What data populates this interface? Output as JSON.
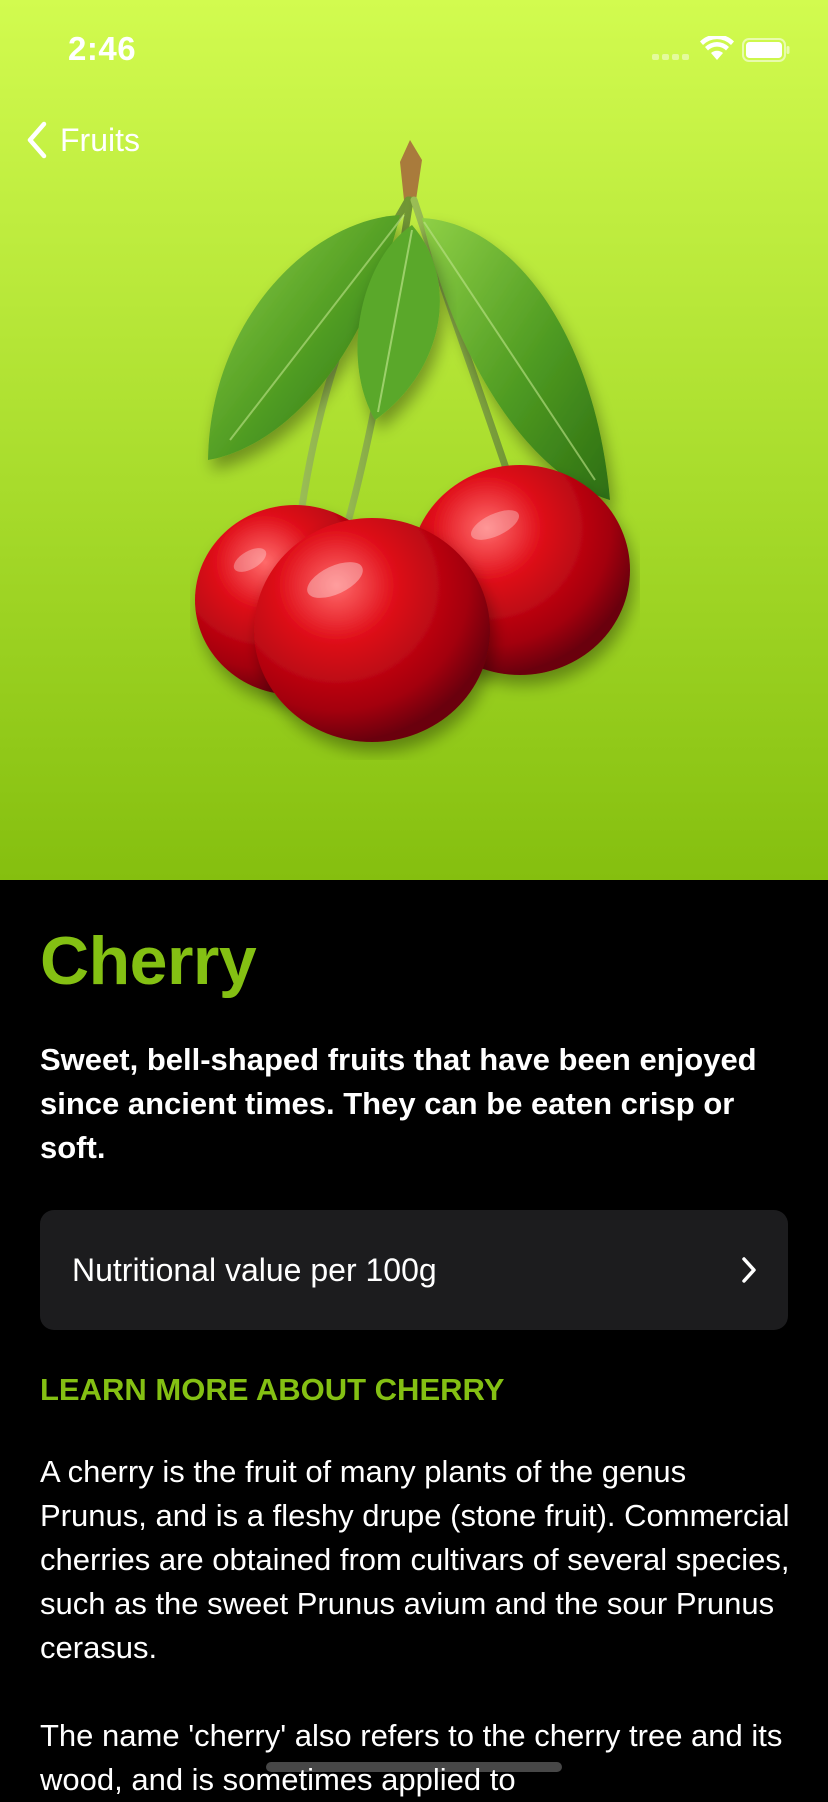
{
  "status_bar": {
    "time": "2:46",
    "icons": [
      "cellular-signal-icon",
      "wifi-icon",
      "battery-icon"
    ]
  },
  "nav": {
    "back_label": "Fruits",
    "back_icon": "chevron-left-icon"
  },
  "hero": {
    "image": "cherry-image",
    "gradient_top": "#d2fb4f",
    "gradient_bottom": "#85bf0f"
  },
  "detail": {
    "title": "Cherry",
    "headline": "Sweet, bell-shaped fruits that have been enjoyed since ancient times. They can be eaten crisp or soft.",
    "nutrition_label": "Nutritional value per 100g",
    "nutrition_icon": "chevron-right-icon",
    "section_title": "LEARN MORE ABOUT CHERRY",
    "paragraph_1": "A cherry is the fruit of many plants of the genus Prunus, and is a fleshy drupe (stone fruit). Commercial cherries are obtained from cultivars of several species, such as the sweet Prunus avium and the sour Prunus cerasus.",
    "paragraph_2": "The name 'cherry' also refers to the cherry tree and its wood, and is sometimes applied to"
  },
  "colors": {
    "accent": "#84c013",
    "background": "#000000",
    "card": "#1c1c1e"
  }
}
